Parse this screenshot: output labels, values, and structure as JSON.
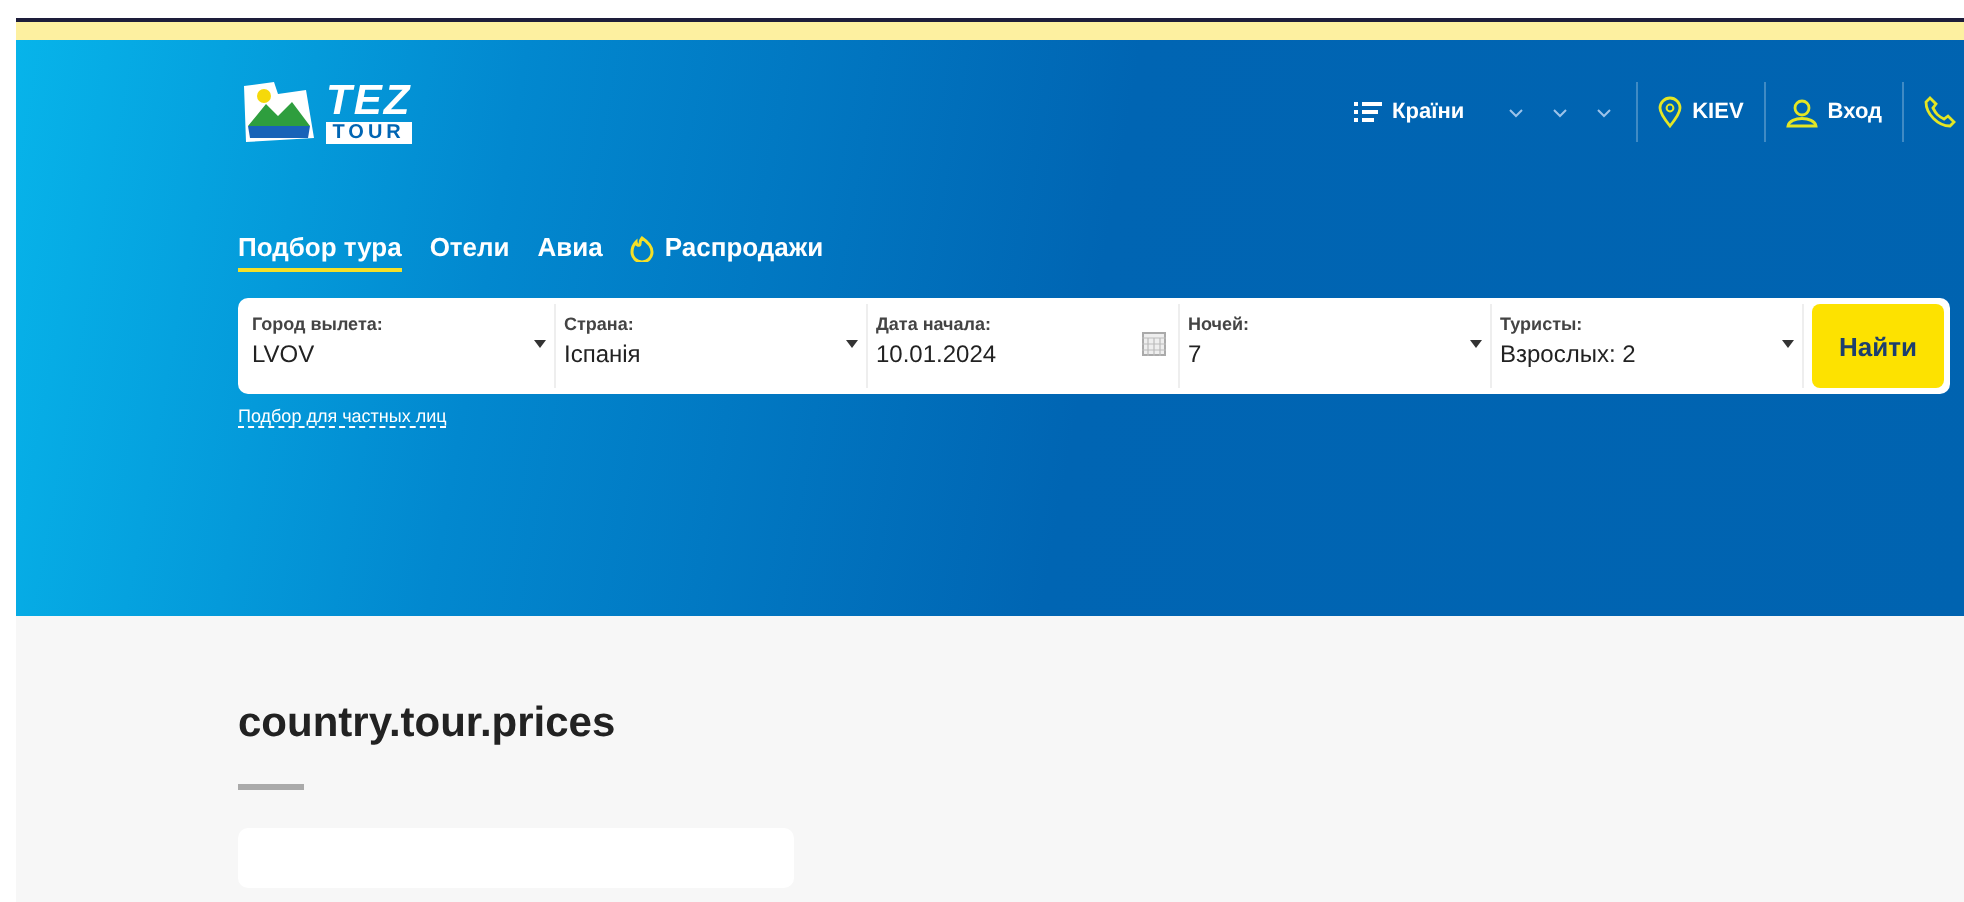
{
  "logo": {
    "line_1": "TEZ",
    "line_2": "TOUR"
  },
  "top_nav": {
    "countries": "Країни",
    "city": "KIEV",
    "login": "Вход"
  },
  "tabs": [
    {
      "label": "Подбор тура",
      "selected": true,
      "kind": "text"
    },
    {
      "label": "Отели",
      "selected": false,
      "kind": "text"
    },
    {
      "label": "Авиа",
      "selected": false,
      "kind": "text"
    },
    {
      "label": "Распродажи",
      "selected": false,
      "kind": "sale"
    }
  ],
  "search_form": {
    "fields": [
      {
        "label": "Город вылета:",
        "value": "LVOV",
        "kind": "select"
      },
      {
        "label": "Страна:",
        "value": "Іспанія",
        "kind": "select"
      },
      {
        "label": "Дата начала:",
        "value": "10.01.2024",
        "kind": "date"
      },
      {
        "label": "Ночей:",
        "value": "7",
        "kind": "select"
      },
      {
        "label": "Туристы:",
        "value": "Взрослых: 2",
        "kind": "select"
      }
    ],
    "button": "Найти",
    "private_link": "Подбор для частных лиц"
  },
  "section": {
    "title": "country.tour.prices"
  }
}
